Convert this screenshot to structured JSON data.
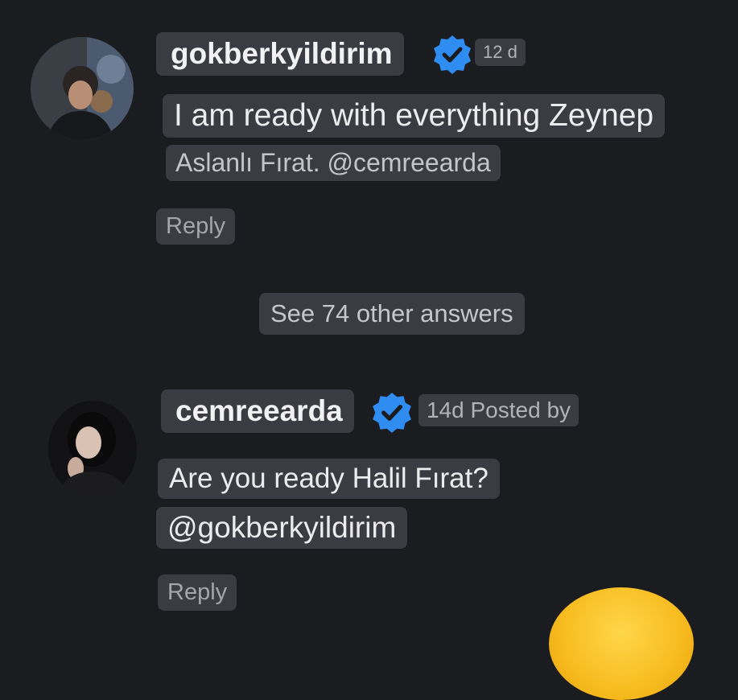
{
  "comments": [
    {
      "username": "gokberkyildirim",
      "time": "12 d",
      "text_line1": "I am ready with everything Zeynep",
      "text_line2": "Aslanlı Fırat. @cemreearda",
      "reply_label": "Reply"
    },
    {
      "username": "cemreearda",
      "time": "14d Posted by",
      "text_line1": "Are you ready Halil Fırat?",
      "text_line2": "@gokberkyildirim",
      "reply_label": "Reply"
    }
  ],
  "see_more_label": "See 74 other answers",
  "colors": {
    "background": "#1b1c20",
    "chip": "#3b3c42",
    "verified": "#2f8cf0",
    "emoji": "#f7bc1f"
  },
  "icons": [
    "verified-badge-icon",
    "verified-badge-icon",
    "emoji-icon"
  ]
}
